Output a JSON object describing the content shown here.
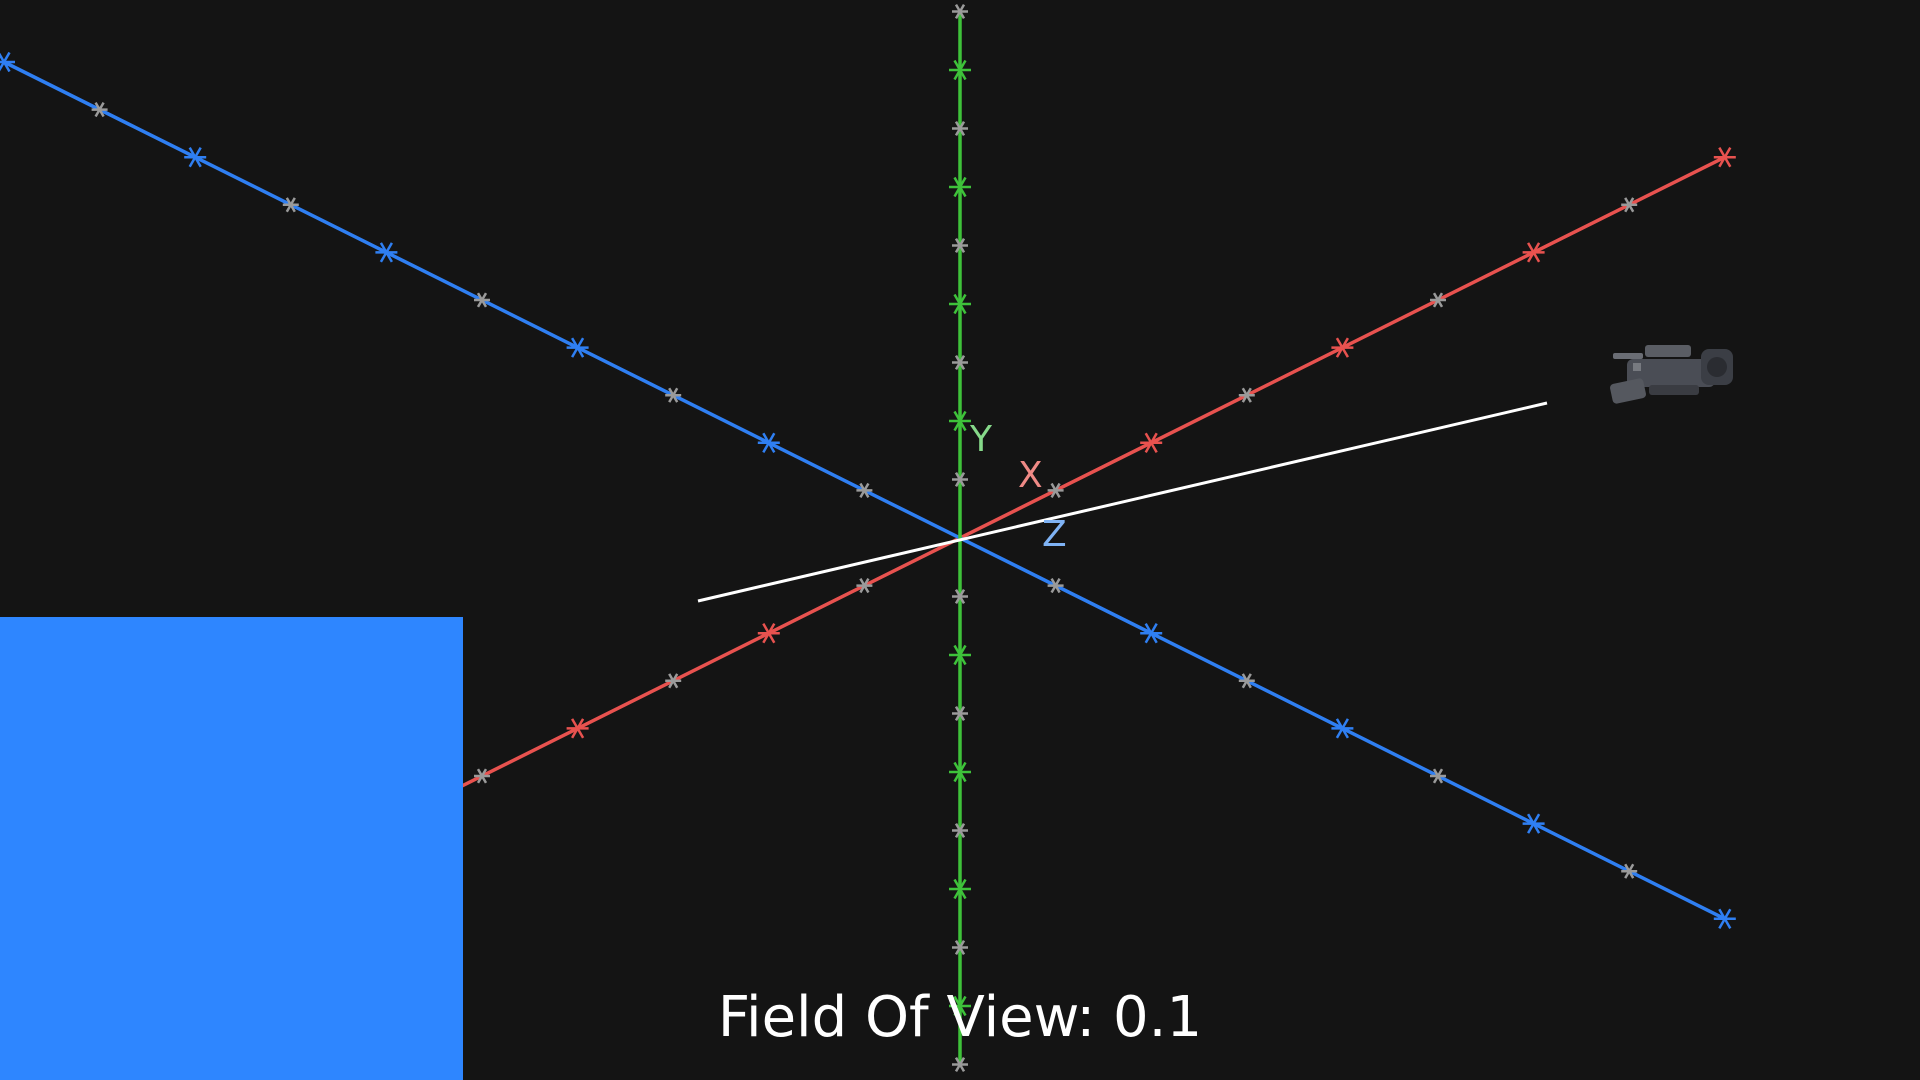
{
  "viewport": {
    "background": "#141414"
  },
  "axes": {
    "x": {
      "label": "X",
      "axis_color": "#e8524f",
      "label_color": "#ef8a86"
    },
    "y": {
      "label": "Y",
      "axis_color": "#3ec23a",
      "label_color": "#86d98a"
    },
    "z": {
      "label": "Z",
      "axis_color": "#2f7ff2",
      "label_color": "#7fb3f5"
    },
    "minor_tick_color": "#9a9a9a"
  },
  "direction_line": {
    "color": "#ffffff"
  },
  "camera": {
    "icon": "video-camera-icon"
  },
  "panel": {
    "color": "#2e86ff"
  },
  "field_of_view": {
    "label": "Field Of View:",
    "value": "0.1"
  }
}
